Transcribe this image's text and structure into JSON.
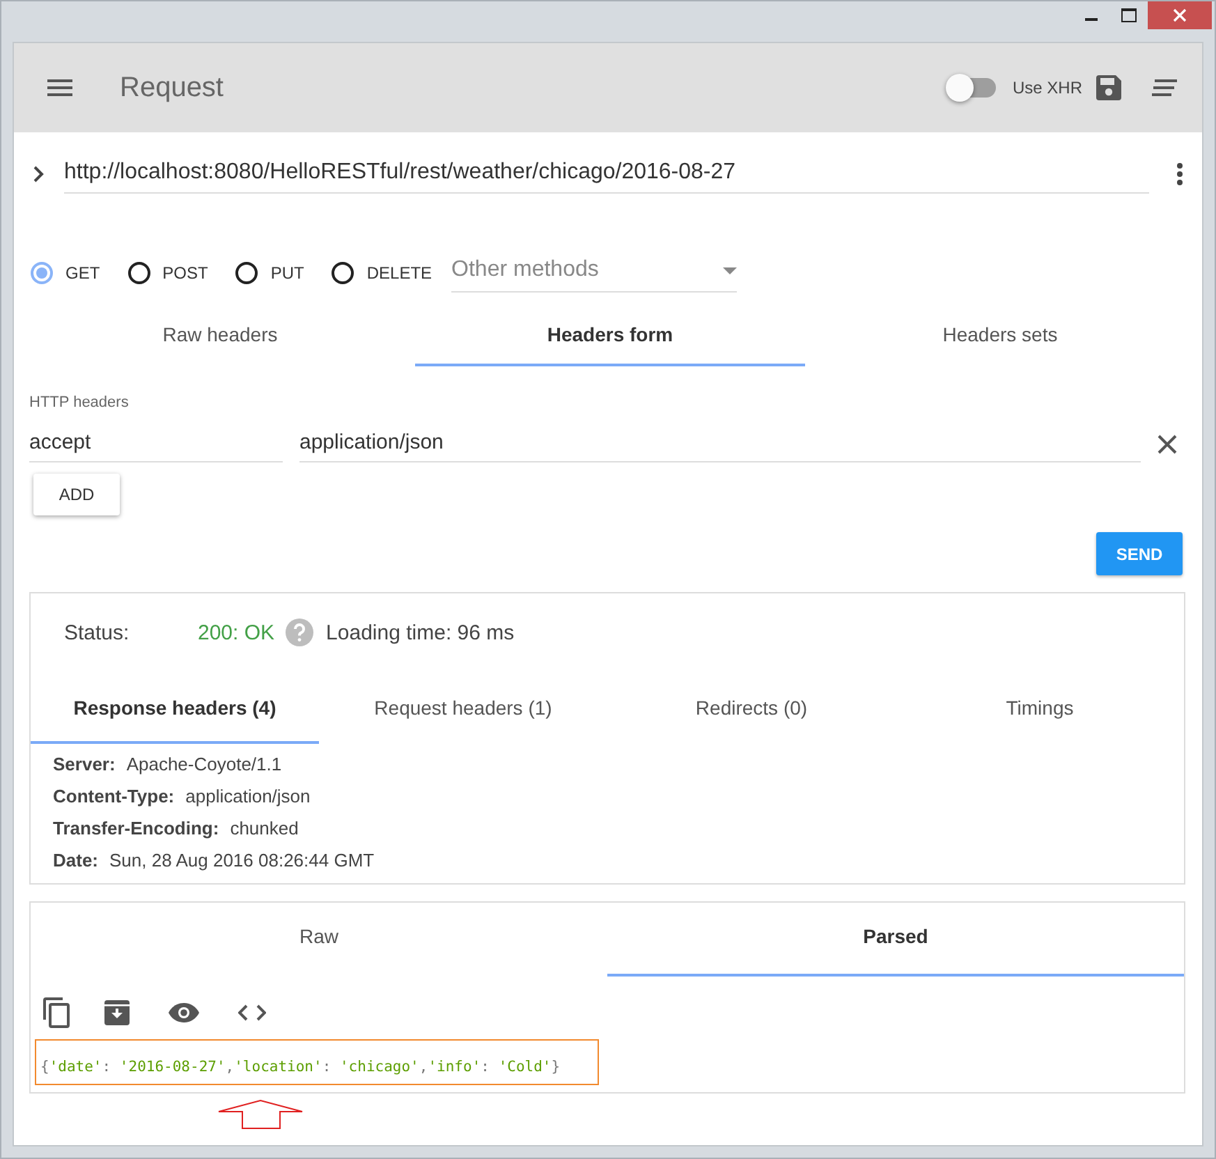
{
  "toolbar": {
    "title": "Request",
    "xhr": {
      "label": "Use XHR",
      "on": false
    }
  },
  "url": "http://localhost:8080/HelloRESTful/rest/weather/chicago/2016-08-27",
  "methods": [
    {
      "label": "GET",
      "selected": true
    },
    {
      "label": "POST",
      "selected": false
    },
    {
      "label": "PUT",
      "selected": false
    },
    {
      "label": "DELETE",
      "selected": false
    }
  ],
  "other_methods": {
    "placeholder": "Other methods"
  },
  "header_tabs": [
    {
      "label": "Raw headers",
      "selected": false
    },
    {
      "label": "Headers form",
      "selected": true
    },
    {
      "label": "Headers sets",
      "selected": false
    }
  ],
  "headers_label": "HTTP headers",
  "headers": [
    {
      "name": "accept",
      "value": "application/json"
    }
  ],
  "add_button": "ADD",
  "send_button": "SEND",
  "status": {
    "label": "Status:",
    "code": "200: OK",
    "loading": "Loading time: 96 ms"
  },
  "response_tabs": [
    {
      "label": "Response headers (4)",
      "selected": true
    },
    {
      "label": "Request headers (1)",
      "selected": false
    },
    {
      "label": "Redirects (0)",
      "selected": false
    },
    {
      "label": "Timings",
      "selected": false
    }
  ],
  "response_headers": [
    {
      "name": "Server:",
      "value": "Apache-Coyote/1.1"
    },
    {
      "name": "Content-Type:",
      "value": "application/json"
    },
    {
      "name": "Transfer-Encoding:",
      "value": "chunked"
    },
    {
      "name": "Date:",
      "value": "Sun, 28 Aug 2016 08:26:44 GMT"
    }
  ],
  "body_tabs": [
    {
      "label": "Raw",
      "selected": false
    },
    {
      "label": "Parsed",
      "selected": true
    }
  ],
  "body": "{'date': '2016-08-27','location': 'chicago','info': 'Cold'}"
}
